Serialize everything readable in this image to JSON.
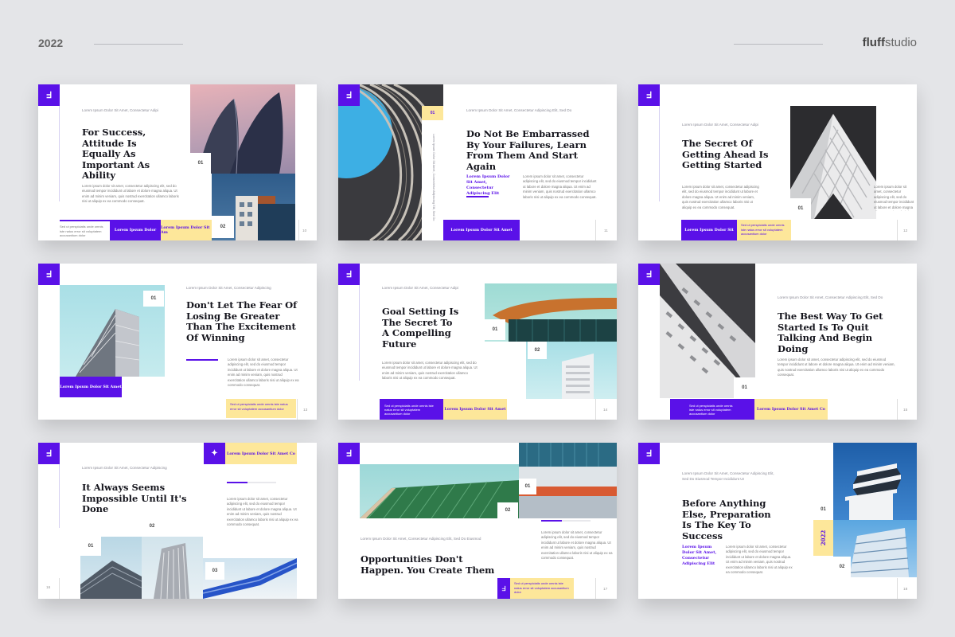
{
  "header": {
    "year": "2022",
    "brand_bold": "fluff",
    "brand_light": "studio"
  },
  "lorem_para": "Lorem ipsum dolor sit amet, consectetur adipiscing elit, sed do eiusmod tempor incididunt ut labore et dolore magna aliqua. Ut enim ad minim veniam, quis nostrud exercitation ullamco laboris nisi ut aliquip ex ea commodo consequat.",
  "lorem_note": "Sed ut perspiciatis unde omnis iste natus error sit voluptatem accusantium dolor",
  "slides": [
    {
      "kicker": "Lorem Ipsum Dolor Sit Amet, Consectetur Adipi",
      "title": "For Success, Attitude Is Equally As Important As Ability",
      "btn1": "Lorem Ipsum Dolor",
      "btn2": "Lorem Ipsum Dolor Sit Am",
      "n1": "01",
      "n2": "02",
      "page": "10"
    },
    {
      "kicker": "Lorem Ipsum Dolor Sit Amet, Consectetur Adipiscing Elit, Sed Do",
      "title": "Do Not Be Embarrassed By Your Failures, Learn From Them And Start Again",
      "sub": "Lorem Ipsum Dolor Sit Amet, Consectetur Adipiscing Elit",
      "vtext": "Lorem Ipsum Dolor Sit Amet, Consectetur Adipiscing Elit, Sed Do",
      "btn1": "Lorem Ipsum Dolor Sit Amet",
      "n1": "01",
      "page": "11"
    },
    {
      "kicker": "Lorem Ipsum Dolor Sit Amet, Consectetur Adipi",
      "title": "The Secret Of Getting Ahead Is Getting Started",
      "btn1": "Lorem Ipsum Dolor Sit",
      "n1": "01",
      "page": "12"
    },
    {
      "kicker": "Lorem Ipsum Dolor Sit Amet, Consectetur Adipiscing",
      "title": "Don't Let The Fear Of Losing Be Greater Than The Excitement Of Winning",
      "btn1": "Lorem Ipsum Dolor Sit Amet",
      "n1": "01",
      "page": "13"
    },
    {
      "kicker": "Lorem Ipsum Dolor Sit Amet, Consectetur Adipi",
      "title": "Goal Setting Is The Secret To A Compelling Future",
      "btn2": "Lorem Ipsum Dolor Sit Amet",
      "n1": "01",
      "n2": "02",
      "page": "14"
    },
    {
      "kicker": "Lorem Ipsum Dolor Sit Amet, Consectetur Adipiscing Elit, Sed Do",
      "title": "The Best Way To Get Started Is To Quit Talking And Begin Doing",
      "btn2": "Lorem Ipsum Dolor Sit Amet Co",
      "n1": "01",
      "page": "15"
    },
    {
      "kicker": "Lorem Ipsum Dolor Sit Amet, Consectetur Adipiscing",
      "title": "It Always Seems Impossible Until It's Done",
      "btn2": "Lorem Ipsum Dolor Sit Amet Co",
      "n1": "01",
      "n2": "02",
      "n3": "03",
      "page": "16"
    },
    {
      "kicker": "Lorem Ipsum Dolor Sit Amet, Consectetur Adipiscing Elit, Sed Do Eiusmod",
      "title": "Opportunities Don't Happen. You Create Them",
      "n1": "01",
      "n2": "02",
      "page": "17"
    },
    {
      "kicker": "Lorem Ipsum Dolor Sit Amet, Consectetur Adipiscing Elit, Sed Do Eiusmod Tempor Incididunt Ut",
      "title": "Before Anything Else, Preparation Is The Key To Success",
      "sub": "Lorem Ipsum Dolor Sit Amet, Consectetur Adipiscing Elit",
      "year": "2022",
      "n1": "01",
      "n2": "02",
      "page": "18"
    }
  ],
  "icons": {
    "logo": "fluff-logo-icon",
    "star": "pin-icon"
  },
  "colors": {
    "accent": "#5a11e8",
    "yellow": "#fde79a",
    "bg": "#e4e5e8"
  }
}
